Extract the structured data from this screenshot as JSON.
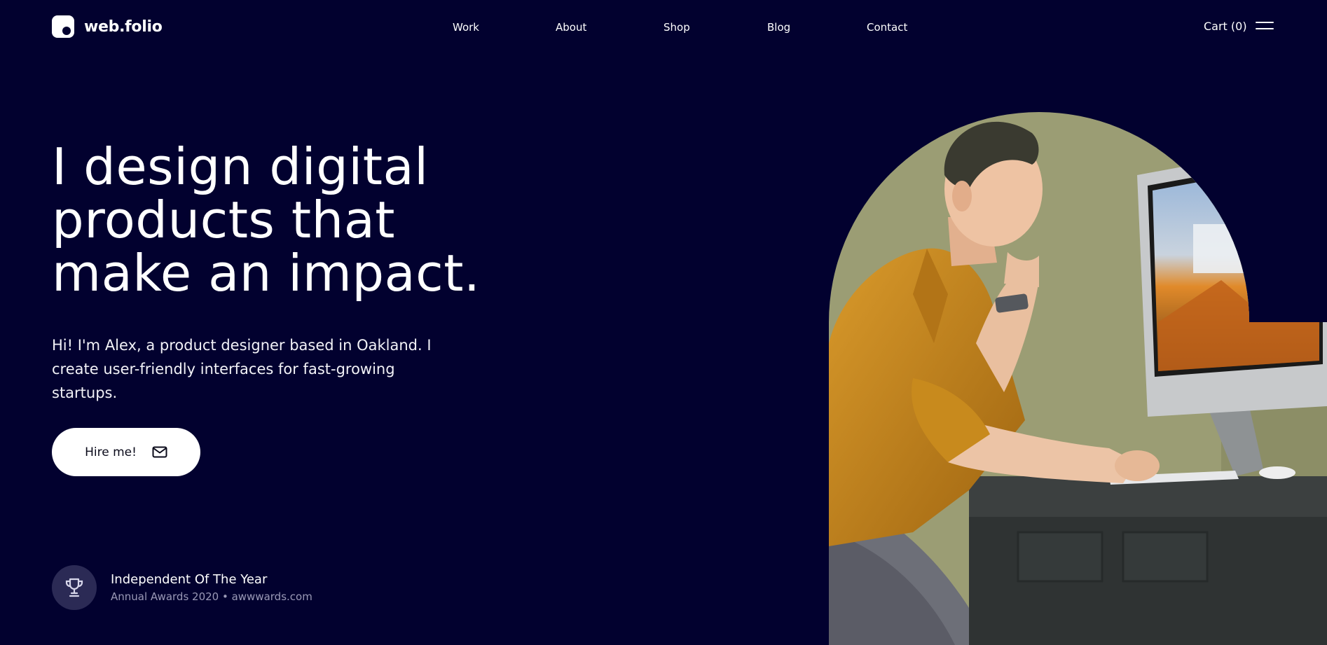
{
  "brand": {
    "name": "web.folio"
  },
  "nav": {
    "items": [
      {
        "label": "Work"
      },
      {
        "label": "About"
      },
      {
        "label": "Shop"
      },
      {
        "label": "Blog"
      },
      {
        "label": "Contact"
      }
    ],
    "cart_label": "Cart (0)",
    "menu_icon": "hamburger-menu-icon"
  },
  "hero": {
    "headline_lines": [
      "I design digital",
      "products that",
      "make an impact."
    ],
    "intro": "Hi! I'm Alex, a product designer based in Oakland. I create user-friendly interfaces for fast-growing startups.",
    "cta_label": "Hire me!",
    "cta_icon": "envelope-icon",
    "image_subject": "designer-at-desktop-computer-photo"
  },
  "award": {
    "icon": "trophy-icon",
    "title": "Independent Of The Year",
    "subtitle": "Annual Awards 2020 • awwwards.com"
  },
  "colors": {
    "background": "#02012f",
    "text": "#ffffff",
    "muted": "#9a99b6",
    "badge": "#2b2a55",
    "button": "#ffffff",
    "photo_backdrop": "#9b9d74",
    "shirt": "#c98a1f"
  }
}
